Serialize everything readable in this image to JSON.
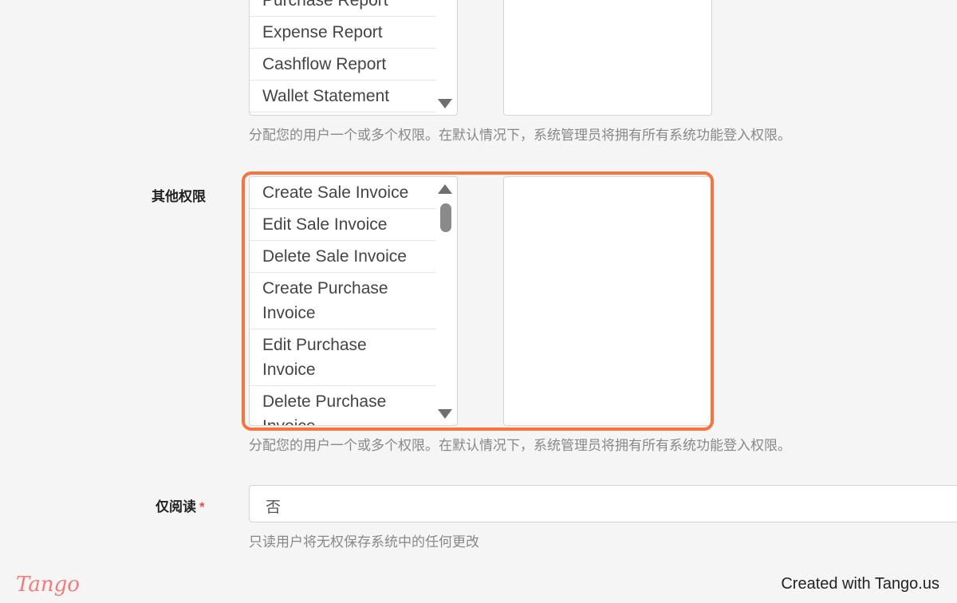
{
  "module_permissions": {
    "items": [
      "Purchase Report",
      "Expense Report",
      "Cashflow Report",
      "Wallet Statement"
    ],
    "help": "分配您的用户一个或多个权限。在默认情况下，系统管理员将拥有所有系统功能登入权限。"
  },
  "other_permissions": {
    "label": "其他权限",
    "items": [
      "Create Sale Invoice",
      "Edit Sale Invoice",
      "Delete Sale Invoice",
      "Create Purchase Invoice",
      "Edit Purchase Invoice",
      "Delete Purchase Invoice"
    ],
    "help": "分配您的用户一个或多个权限。在默认情况下，系统管理员将拥有所有系统功能登入权限。"
  },
  "read_only": {
    "label": "仅阅读",
    "required_mark": "*",
    "value": "否",
    "help": "只读用户将无权保存系统中的任何更改"
  },
  "footer": {
    "logo": "Tango",
    "credit": "Created with Tango.us"
  }
}
